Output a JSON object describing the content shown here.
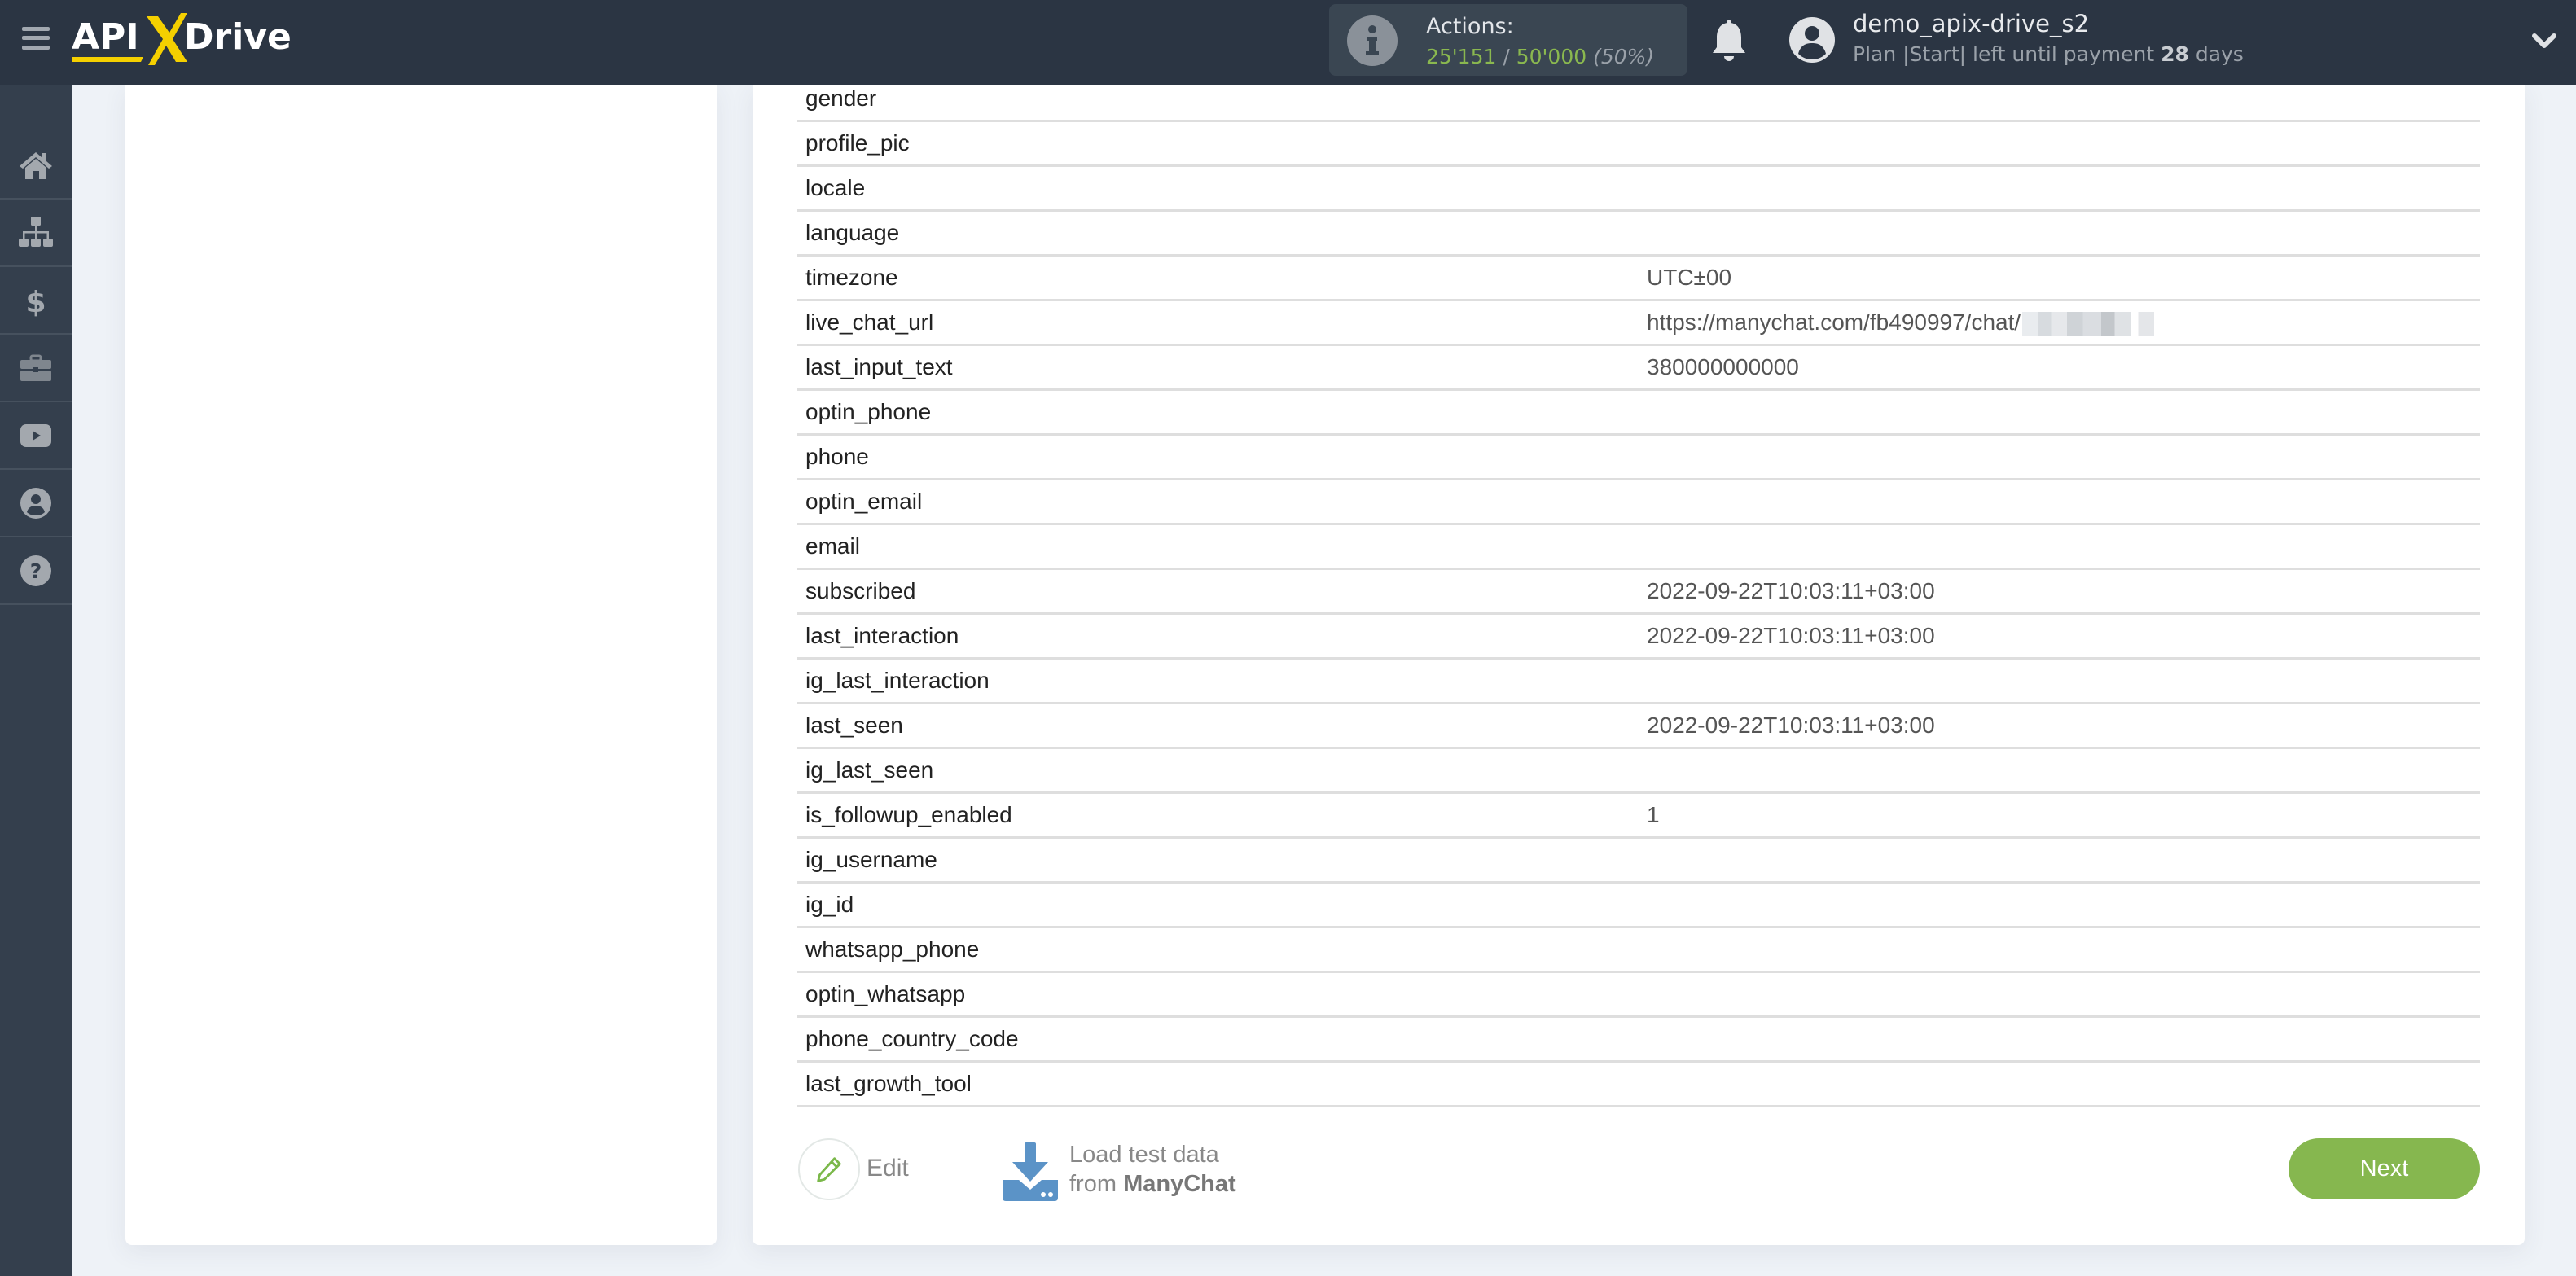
{
  "header": {
    "logo_text": "APIXDrive",
    "actions": {
      "label": "Actions:",
      "used": "25'151",
      "separator": " / ",
      "limit": "50'000",
      "percent": "(50%)"
    },
    "user": {
      "name": "demo_apix-drive_s2",
      "plan_prefix": "Plan |Start| left until payment ",
      "days_left": "28",
      "days_suffix": " days"
    }
  },
  "sidebar": {
    "items": [
      {
        "icon": "home-icon",
        "label": "Home"
      },
      {
        "icon": "sitemap-icon",
        "label": "Connections"
      },
      {
        "icon": "dollar-icon",
        "label": "Billing"
      },
      {
        "icon": "briefcase-icon",
        "label": "Tools"
      },
      {
        "icon": "youtube-icon",
        "label": "Video"
      },
      {
        "icon": "user-circle-icon",
        "label": "Account"
      },
      {
        "icon": "help-icon",
        "label": "Help"
      }
    ]
  },
  "table": {
    "rows": [
      {
        "key": "gender",
        "value": ""
      },
      {
        "key": "profile_pic",
        "value": ""
      },
      {
        "key": "locale",
        "value": ""
      },
      {
        "key": "language",
        "value": ""
      },
      {
        "key": "timezone",
        "value": "UTC±00"
      },
      {
        "key": "live_chat_url",
        "value": "https://manychat.com/fb490997/chat/",
        "redacted": true
      },
      {
        "key": "last_input_text",
        "value": "380000000000"
      },
      {
        "key": "optin_phone",
        "value": ""
      },
      {
        "key": "phone",
        "value": ""
      },
      {
        "key": "optin_email",
        "value": ""
      },
      {
        "key": "email",
        "value": ""
      },
      {
        "key": "subscribed",
        "value": "2022-09-22T10:03:11+03:00"
      },
      {
        "key": "last_interaction",
        "value": "2022-09-22T10:03:11+03:00"
      },
      {
        "key": "ig_last_interaction",
        "value": ""
      },
      {
        "key": "last_seen",
        "value": "2022-09-22T10:03:11+03:00"
      },
      {
        "key": "ig_last_seen",
        "value": ""
      },
      {
        "key": "is_followup_enabled",
        "value": "1"
      },
      {
        "key": "ig_username",
        "value": ""
      },
      {
        "key": "ig_id",
        "value": ""
      },
      {
        "key": "whatsapp_phone",
        "value": ""
      },
      {
        "key": "optin_whatsapp",
        "value": ""
      },
      {
        "key": "phone_country_code",
        "value": ""
      },
      {
        "key": "last_growth_tool",
        "value": ""
      }
    ]
  },
  "footer": {
    "edit_label": "Edit",
    "load_line1": "Load test data",
    "load_from": "from ",
    "load_source": "ManyChat",
    "next_label": "Next"
  },
  "colors": {
    "header_bg": "#2b3543",
    "sidebar_bg": "#343f4d",
    "accent_green": "#86b74f",
    "logo_yellow": "#f5d000",
    "download_blue": "#5b93c7"
  }
}
